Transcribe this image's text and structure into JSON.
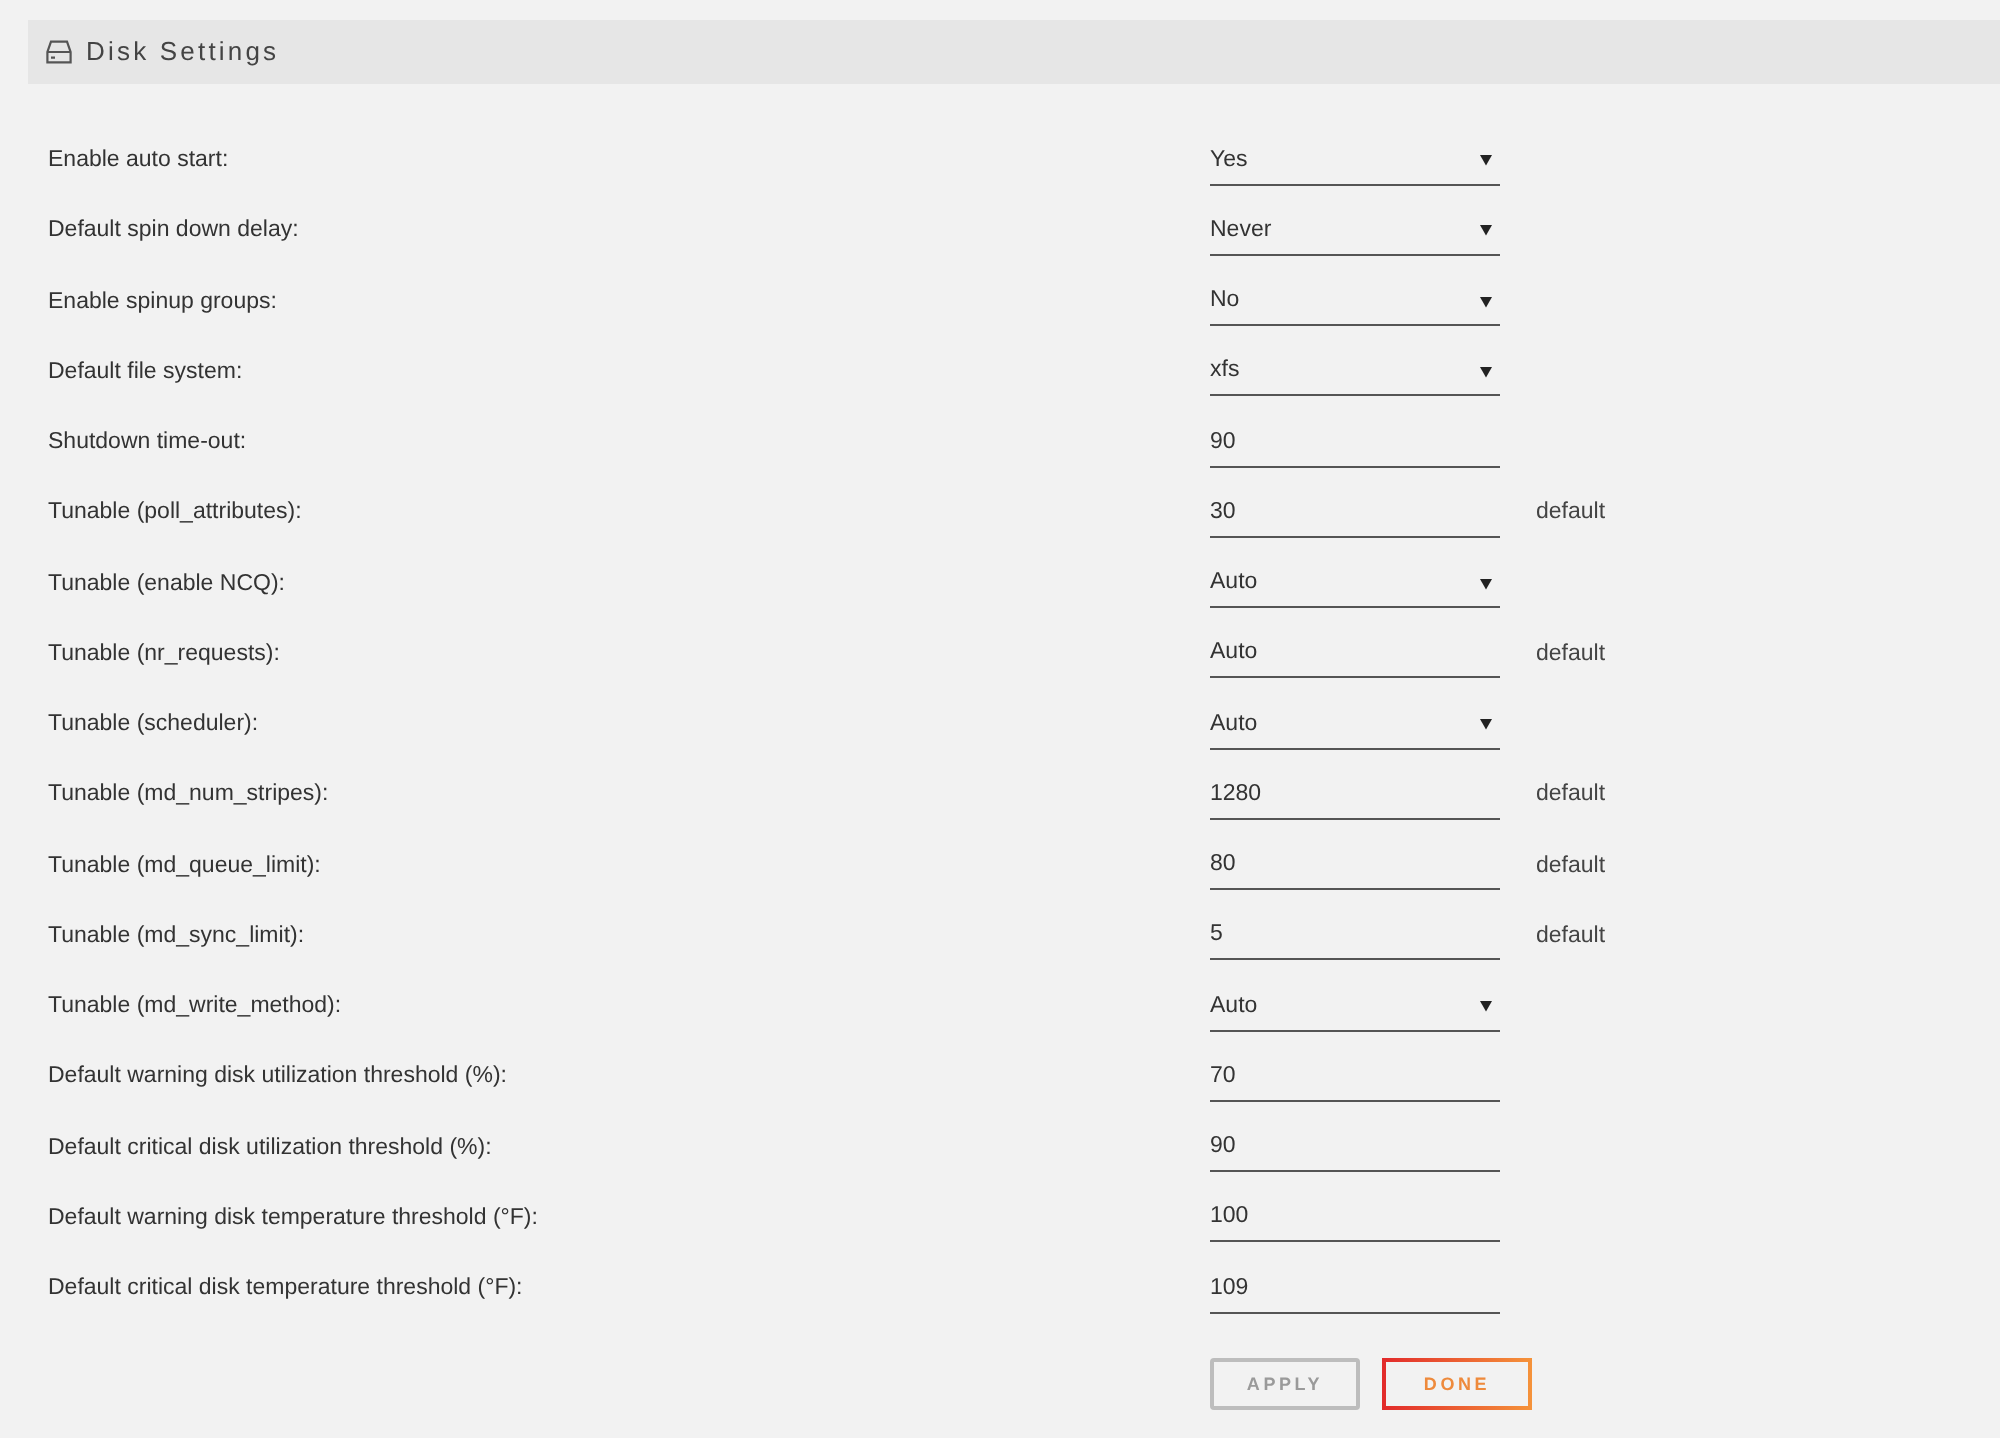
{
  "section": {
    "title": "Disk Settings"
  },
  "settings": [
    {
      "kind": "select",
      "label": "Enable auto start:",
      "value": "Yes"
    },
    {
      "kind": "select",
      "label": "Default spin down delay:",
      "value": "Never"
    },
    {
      "kind": "select",
      "label": "Enable spinup groups:",
      "value": "No"
    },
    {
      "kind": "select",
      "label": "Default file system:",
      "value": "xfs"
    },
    {
      "kind": "input",
      "label": "Shutdown time-out:",
      "value": "90"
    },
    {
      "kind": "input",
      "label": "Tunable (poll_attributes):",
      "value": "30",
      "note": "default"
    },
    {
      "kind": "select",
      "label": "Tunable (enable NCQ):",
      "value": "Auto"
    },
    {
      "kind": "input",
      "label": "Tunable (nr_requests):",
      "value": "Auto",
      "note": "default"
    },
    {
      "kind": "select",
      "label": "Tunable (scheduler):",
      "value": "Auto"
    },
    {
      "kind": "input",
      "label": "Tunable (md_num_stripes):",
      "value": "1280",
      "note": "default"
    },
    {
      "kind": "input",
      "label": "Tunable (md_queue_limit):",
      "value": "80",
      "note": "default"
    },
    {
      "kind": "input",
      "label": "Tunable (md_sync_limit):",
      "value": "5",
      "note": "default"
    },
    {
      "kind": "select",
      "label": "Tunable (md_write_method):",
      "value": "Auto"
    },
    {
      "kind": "input",
      "label": "Default warning disk utilization threshold (%):",
      "value": "70"
    },
    {
      "kind": "input",
      "label": "Default critical disk utilization threshold (%):",
      "value": "90"
    },
    {
      "kind": "input",
      "label": "Default warning disk temperature threshold (°F):",
      "value": "100"
    },
    {
      "kind": "input",
      "label": "Default critical disk temperature threshold (°F):",
      "value": "109"
    }
  ],
  "buttons": [
    {
      "label": "APPLY",
      "disabled": true
    },
    {
      "label": "DONE",
      "disabled": false
    }
  ]
}
